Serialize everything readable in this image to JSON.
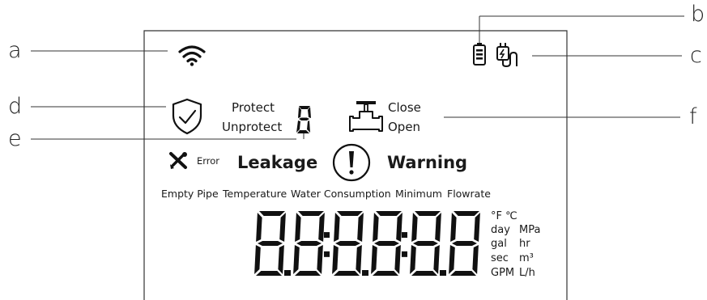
{
  "callouts": {
    "a": "a",
    "b": "b",
    "c": "c",
    "d": "d",
    "e": "e",
    "f": "f"
  },
  "protection": {
    "protect": "Protect",
    "unprotect": "Unprotect",
    "digit": "8"
  },
  "valve": {
    "close": "Close",
    "open": "Open"
  },
  "alerts": {
    "error": "Error",
    "leakage": "Leakage",
    "warning": "Warning"
  },
  "modes": {
    "empty_pipe": "Empty Pipe",
    "temperature": "Temperature",
    "water_consumption": "Water Consumption",
    "minimum": "Minimum",
    "flowrate": "Flowrate"
  },
  "display": {
    "digits": [
      "8",
      "8",
      "8",
      "8",
      "8",
      "8"
    ],
    "separators": [
      ".",
      ":",
      ".",
      ":",
      "."
    ]
  },
  "units": {
    "temp": "°F ℃",
    "day": "day",
    "mpa": "MPa",
    "gal": "gal",
    "hr": "hr",
    "sec": "sec",
    "m3": "m³",
    "gpm": "GPM",
    "lh": "L/h"
  },
  "icons": {
    "wifi": "wifi-icon",
    "battery": "battery-icon",
    "power": "power-plug-icon",
    "shield": "shield-check-icon",
    "valve": "valve-icon",
    "tools": "tools-icon",
    "warning": "exclamation-icon"
  }
}
